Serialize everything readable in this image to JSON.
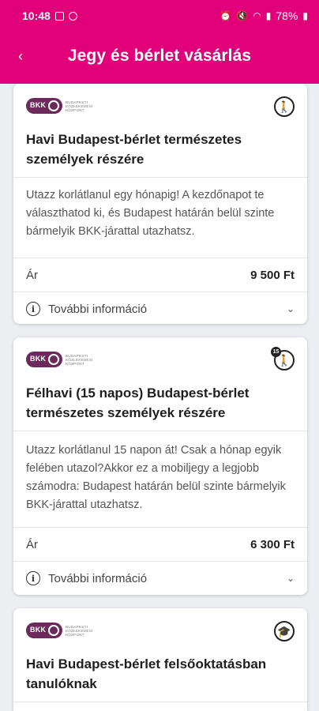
{
  "status_bar": {
    "time": "10:48",
    "battery": "78%"
  },
  "header": {
    "title": "Jegy és bérlet vásárlás",
    "back_label": "‹"
  },
  "logo": {
    "badge": "BKK",
    "lines": [
      "BUDAPESTI",
      "KÖZLEKEDÉSI",
      "KÖZPONT"
    ]
  },
  "cards": [
    {
      "category_icon": "person-icon",
      "title": "Havi Budapest-bérlet természetes személyek részére",
      "description": "Utazz korlátlanul egy hónapig! A kezdőnapot te választhatod ki, és Budapest határán belül szinte bármelyik BKK-járattal utazhatsz.",
      "price_label": "Ár",
      "price": "9 500 Ft",
      "info_label": "További információ"
    },
    {
      "category_icon": "person-15-icon",
      "category_badge": "15",
      "title": "Félhavi (15 napos) Budapest-bérlet természetes személyek részére",
      "description": "Utazz korlátlanul 15 napon át! Csak a hónap egyik felében utazol?Akkor ez a mobiljegy a legjobb számodra: Budapest határán belül szinte bármelyik BKK-járattal utazhatsz.",
      "price_label": "Ár",
      "price": "6 300 Ft",
      "info_label": "További információ"
    },
    {
      "category_icon": "graduation-cap-icon",
      "title": "Havi Budapest-bérlet felsőoktatásban tanulóknak"
    }
  ],
  "colors": {
    "brand": "#e2007a",
    "logo": "#6b2a5a"
  }
}
